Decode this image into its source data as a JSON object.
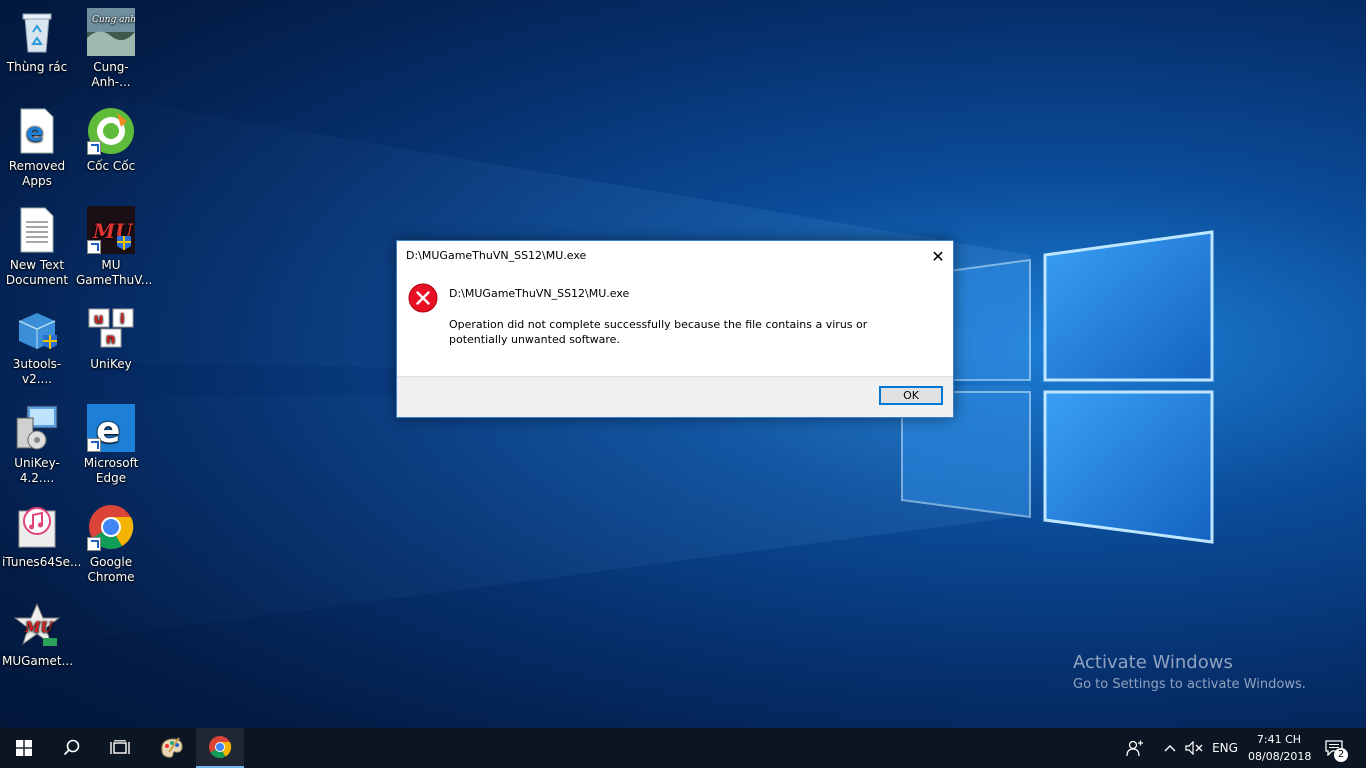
{
  "desktop": {
    "icons": [
      {
        "label": "Thùng rác",
        "icon": "recycle-bin-icon"
      },
      {
        "label": "Cung-Anh-...",
        "icon": "image-file-icon"
      },
      {
        "label": "Removed Apps",
        "icon": "edge-legacy-icon"
      },
      {
        "label": "Cốc Cốc",
        "icon": "coccoc-icon"
      },
      {
        "label": "New Text Document",
        "icon": "text-document-icon"
      },
      {
        "label": "MU GameThuV...",
        "icon": "mu-game-icon"
      },
      {
        "label": "3utools-v2....",
        "icon": "package-icon"
      },
      {
        "label": "UniKey",
        "icon": "unikey-icon"
      },
      {
        "label": "UniKey-4.2....",
        "icon": "installer-icon"
      },
      {
        "label": "Microsoft Edge",
        "icon": "edge-icon"
      },
      {
        "label": "iTunes64Se...",
        "icon": "itunes-icon"
      },
      {
        "label": "Google Chrome",
        "icon": "chrome-icon"
      },
      {
        "label": "MUGamet...",
        "icon": "mu-game-installer-icon"
      }
    ]
  },
  "dialog": {
    "title": "D:\\MUGameThuVN_SS12\\MU.exe",
    "path": "D:\\MUGameThuVN_SS12\\MU.exe",
    "message": "Operation did not complete successfully because the file contains a virus or potentially unwanted software.",
    "ok_label": "OK",
    "close_glyph": "✕"
  },
  "watermark": {
    "title": "Activate Windows",
    "subtitle": "Go to Settings to activate Windows."
  },
  "taskbar": {
    "language": "ENG",
    "time": "7:41 CH",
    "date": "08/08/2018",
    "notification_count": "2"
  },
  "colors": {
    "accent": "#0078d7",
    "error_red": "#e81123",
    "taskbar": "#0c1522"
  }
}
